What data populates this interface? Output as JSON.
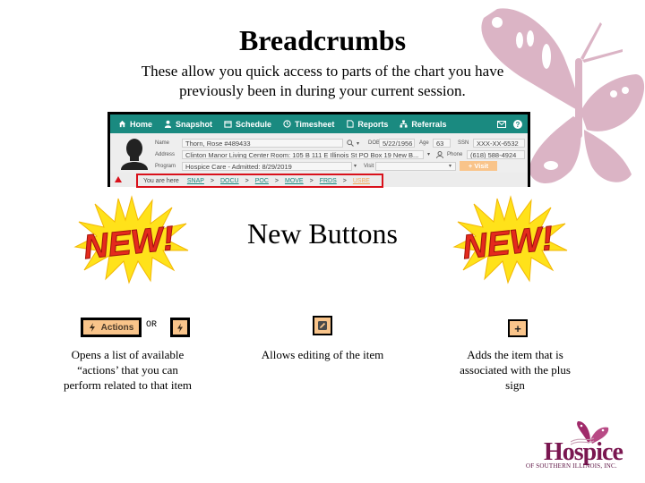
{
  "slide": {
    "title": "Breadcrumbs",
    "subtitle": "These allow you quick access to parts of the chart you have previously been in during your current session.",
    "section_title": "New Buttons"
  },
  "app": {
    "nav": [
      {
        "label": "Home",
        "icon": "home-icon"
      },
      {
        "label": "Snapshot",
        "icon": "person-icon"
      },
      {
        "label": "Schedule",
        "icon": "calendar-icon"
      },
      {
        "label": "Timesheet",
        "icon": "clock-icon"
      },
      {
        "label": "Reports",
        "icon": "document-icon"
      },
      {
        "label": "Referrals",
        "icon": "org-icon"
      }
    ],
    "nav_right_icons": [
      "mail-icon",
      "help-icon"
    ],
    "patient": {
      "name_label": "Name",
      "name": "Thorn, Rose #489433",
      "address_label": "Address",
      "address": "Clinton Manor Living Center Room: 105 B 111 E Illinois St PO Box 19 New B...",
      "program_label": "Program",
      "program": "Hospice Care - Admitted: 8/29/2019",
      "dob_label": "DOB",
      "dob": "5/22/1956",
      "age_label": "Age",
      "age": "63",
      "ssn_label": "SSN",
      "ssn": "XXX-XX-6532",
      "phone_label": "Phone",
      "phone": "(618) 588-4924",
      "visit_label": "Visit",
      "visit_value": "",
      "visit_button": "+ Visit"
    },
    "breadcrumbs": {
      "you_are_here": "You are here",
      "items": [
        "SNAP",
        "DOCU",
        "POC",
        "MOVE",
        "FRDS",
        "USBE"
      ],
      "separator": ">",
      "highlight_color": "#d9111b"
    },
    "accent_color": "#1a8a80",
    "button_color": "#f9c48a"
  },
  "buttons": {
    "actions_label": "Actions",
    "or_label": "OR",
    "plus_label": "+",
    "actions_desc": "Opens a list of available “actions’ that you can perform related to that item",
    "edit_desc": "Allows editing of the item",
    "plus_desc": "Adds the item that is associated with the plus sign"
  },
  "badges": {
    "new_text": "NEW!"
  },
  "logo": {
    "name": "Hospice",
    "subtitle": "OF SOUTHERN ILLINOIS, INC."
  }
}
